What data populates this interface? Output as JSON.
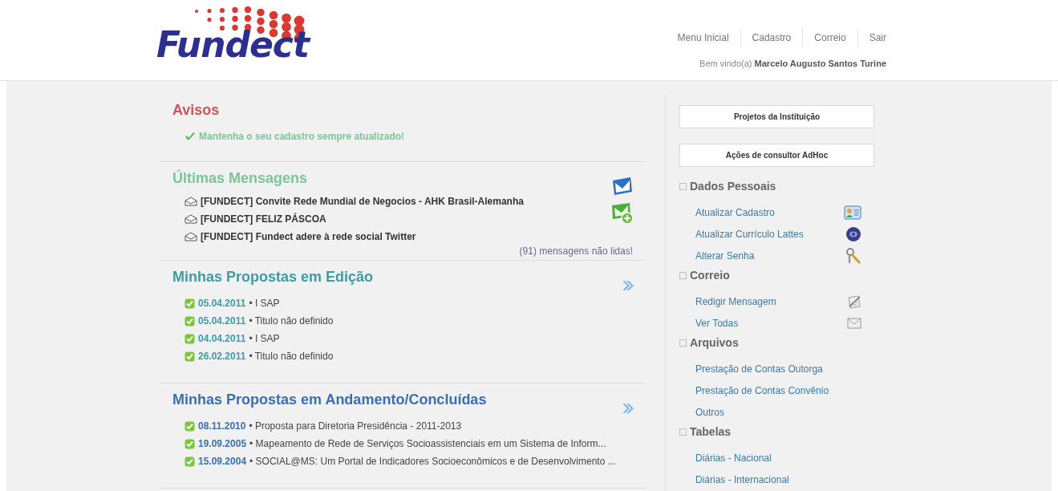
{
  "header": {
    "logo": "Fundect",
    "nav": [
      {
        "label": "Menu Inicial"
      },
      {
        "label": "Cadastro"
      },
      {
        "label": "Correio"
      },
      {
        "label": "Sair"
      }
    ],
    "welcome": {
      "prefix": "Bem vindo(a)",
      "user": "Marcelo Augusto Santos Turine"
    }
  },
  "sections": [
    {
      "kind": "notices",
      "title": "Avisos",
      "color": "#c9585a",
      "items": [
        "Mantenha o seu cadastro sempre atualizado!"
      ]
    },
    {
      "kind": "messages",
      "title": "Últimas Mensagens",
      "color": "#7cc59b",
      "items": [
        "[FUNDECT] Convite Rede Mundial de Negocios - AHK Brasil-Alemanha",
        "[FUNDECT] FELIZ PÁSCOA",
        "[FUNDECT] Fundect adere à rede social Twitter"
      ],
      "footer": "(91) mensagens não lidas!"
    },
    {
      "kind": "proposals",
      "title": "Minhas Propostas em Edição",
      "color": "#3d9ca6",
      "items": [
        {
          "date": "05.04.2011",
          "title": "• I SAP"
        },
        {
          "date": "05.04.2011",
          "title": "• Titulo não definido"
        },
        {
          "date": "04.04.2011",
          "title": "• I SAP"
        },
        {
          "date": "26.02.2011",
          "title": "• Titulo não definido"
        }
      ]
    },
    {
      "kind": "proposals",
      "title": "Minhas Propostas em Andamento/Concluídas",
      "color": "#3b6fb5",
      "items": [
        {
          "date": "08.11.2010",
          "title": "• Proposta para Diretoria Presidência - 2011-2013"
        },
        {
          "date": "19.09.2005",
          "title": "• Mapeamento de Rede de Serviços Socioassistenciais em um Sistema de Inform..."
        },
        {
          "date": "15.09.2004",
          "title": "• SOCIAL@MS: Um Portal de Indicadores Socioeconômicos e de Desenvolvimento ..."
        }
      ]
    }
  ],
  "sidebar": {
    "buttons": [
      "Projetos da Instituição",
      "Ações de consultor AdHoc"
    ],
    "groups": [
      {
        "title": "Dados Pessoais",
        "items": [
          "Atualizar Cadastro",
          "Atualizar Currículo Lattes",
          "Alterar Senha"
        ]
      },
      {
        "title": "Correio",
        "items": [
          "Redigir Mensagem",
          "Ver Todas"
        ]
      },
      {
        "title": "Arquivos",
        "items": [
          "Prestação de Contas Outorga",
          "Prestação de Contas Convênio",
          "Outros"
        ]
      },
      {
        "title": "Tabelas",
        "items": [
          "Diárias - Nacional",
          "Diárias - Internacional"
        ]
      }
    ]
  }
}
